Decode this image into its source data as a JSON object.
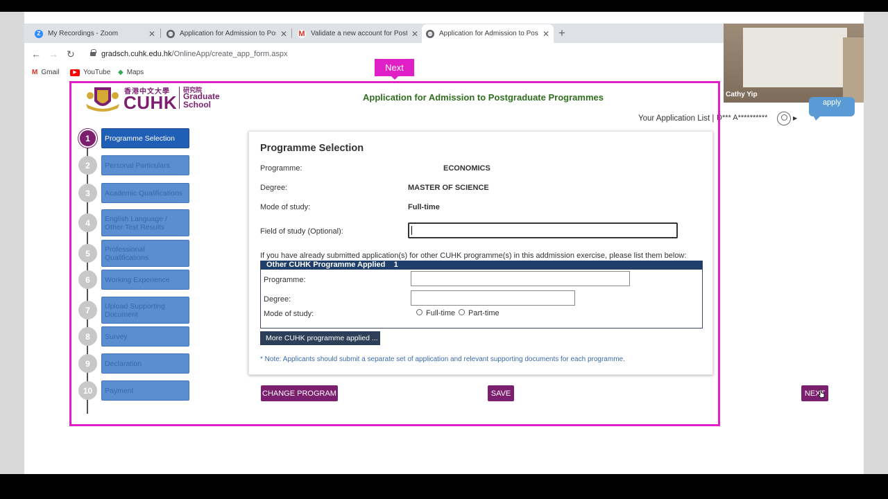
{
  "browser": {
    "tabs": [
      {
        "title": "My Recordings - Zoom",
        "icon": "zoom-icon"
      },
      {
        "title": "Application for Admission to Pos",
        "icon": "globe-icon"
      },
      {
        "title": "Validate a new account for Postg",
        "icon": "gmail-icon"
      },
      {
        "title": "Application for Admission to Pos",
        "icon": "globe-icon",
        "active": true
      }
    ],
    "url_host": "gradsch.cuhk.edu.hk",
    "url_path": "/OnlineApp/create_app_form.aspx",
    "bookmarks": [
      "Gmail",
      "YouTube",
      "Maps"
    ]
  },
  "webcam": {
    "name": "Cathy Yip"
  },
  "annotation": {
    "tooltip": "Next",
    "color": "#e01fc7"
  },
  "header": {
    "logo_zh": "香港中文大學",
    "logo_cuhk": "CUHK",
    "logo_zh2": "研究院",
    "logo_gs1": "Graduate",
    "logo_gs2": "School",
    "title": "Application for Admission to Postgraduate Programmes",
    "app_list": "Your Application List |",
    "user": "D*** A**********",
    "apply_bubble": "apply"
  },
  "steps": [
    {
      "num": "1",
      "label": "Programme Selection",
      "active": true
    },
    {
      "num": "2",
      "label": "Personal Particulars"
    },
    {
      "num": "3",
      "label": "Academic Qualifications"
    },
    {
      "num": "4",
      "label": "English Language / Other Test Results"
    },
    {
      "num": "5",
      "label": "Professional Qualifications"
    },
    {
      "num": "6",
      "label": "Working Experience"
    },
    {
      "num": "7",
      "label": "Upload Supporting Document"
    },
    {
      "num": "8",
      "label": "Survey"
    },
    {
      "num": "9",
      "label": "Declaration"
    },
    {
      "num": "10",
      "label": "Payment"
    }
  ],
  "form": {
    "title": "Programme Selection",
    "programme_label": "Programme:",
    "programme_value": "ECONOMICS",
    "degree_label": "Degree:",
    "degree_value": "MASTER OF SCIENCE",
    "mode_label": "Mode of study:",
    "mode_value": "Full-time",
    "field_label": "Field of study (Optional):",
    "field_value": "",
    "other_intro": "If you have already submitted application(s) for other CUHK programme(s) in this addmission exercise, please list them below:",
    "other_header": "Other CUHK Programme Applied",
    "other_num": "1",
    "other_programme_label": "Programme:",
    "other_programme_value": "",
    "other_degree_label": "Degree:",
    "other_degree_value": "",
    "other_mode_label": "Mode of study:",
    "opt_fulltime": "Full-time",
    "opt_parttime": "Part-time",
    "more_button": "More CUHK programme applied ...",
    "note": "* Note: Applicants should submit a separate set of application and relevant supporting documents for each programme."
  },
  "actions": {
    "change": "CHANGE PROGRAM",
    "save": "SAVE",
    "next": "NEXT"
  }
}
